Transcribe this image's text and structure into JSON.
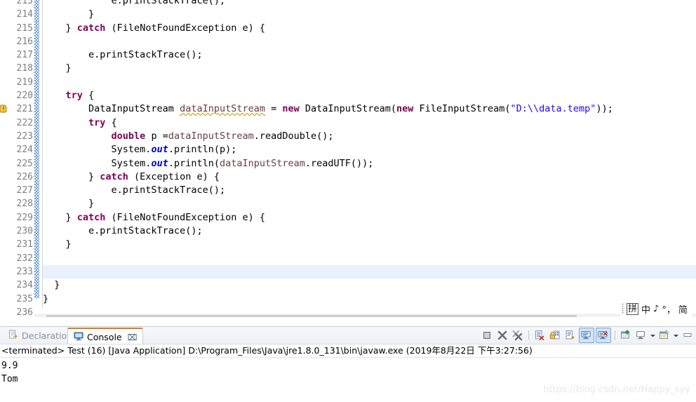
{
  "editor": {
    "current_line_number": 233,
    "warning_line": 221,
    "first_visible_line": 213,
    "lines": [
      {
        "n": 213,
        "clipped": true,
        "tokens": [
          {
            "t": "            e.printStackTrace();",
            "c": "plain"
          }
        ]
      },
      {
        "n": 214,
        "tokens": [
          {
            "t": "        }",
            "c": "plain"
          }
        ]
      },
      {
        "n": 215,
        "tokens": [
          {
            "t": "    } ",
            "c": "plain"
          },
          {
            "t": "catch",
            "c": "kw"
          },
          {
            "t": " (FileNotFoundException e) {",
            "c": "plain"
          }
        ]
      },
      {
        "n": 216,
        "tokens": [
          {
            "t": "",
            "c": "plain"
          }
        ]
      },
      {
        "n": 217,
        "tokens": [
          {
            "t": "        e.printStackTrace();",
            "c": "plain"
          }
        ]
      },
      {
        "n": 218,
        "tokens": [
          {
            "t": "    }",
            "c": "plain"
          }
        ]
      },
      {
        "n": 219,
        "tokens": [
          {
            "t": "",
            "c": "plain"
          }
        ]
      },
      {
        "n": 220,
        "tokens": [
          {
            "t": "    ",
            "c": "plain"
          },
          {
            "t": "try",
            "c": "kw"
          },
          {
            "t": " {",
            "c": "plain"
          }
        ]
      },
      {
        "n": 221,
        "tokens": [
          {
            "t": "        DataInputStream ",
            "c": "plain"
          },
          {
            "t": "dataInputStream",
            "c": "warnu"
          },
          {
            "t": " = ",
            "c": "plain"
          },
          {
            "t": "new",
            "c": "kw"
          },
          {
            "t": " DataInputStream(",
            "c": "plain"
          },
          {
            "t": "new",
            "c": "kw"
          },
          {
            "t": " FileInputStream(",
            "c": "plain"
          },
          {
            "t": "\"D:\\\\data.temp\"",
            "c": "str"
          },
          {
            "t": "));",
            "c": "plain"
          }
        ]
      },
      {
        "n": 222,
        "tokens": [
          {
            "t": "        ",
            "c": "plain"
          },
          {
            "t": "try",
            "c": "kw"
          },
          {
            "t": " {",
            "c": "plain"
          }
        ]
      },
      {
        "n": 223,
        "tokens": [
          {
            "t": "            ",
            "c": "plain"
          },
          {
            "t": "double",
            "c": "kw"
          },
          {
            "t": " p =",
            "c": "plain"
          },
          {
            "t": "dataInputStream",
            "c": "loc"
          },
          {
            "t": ".readDouble();",
            "c": "plain"
          }
        ]
      },
      {
        "n": 224,
        "tokens": [
          {
            "t": "            System.",
            "c": "plain"
          },
          {
            "t": "out",
            "c": "fld"
          },
          {
            "t": ".println(p);",
            "c": "plain"
          }
        ]
      },
      {
        "n": 225,
        "tokens": [
          {
            "t": "            System.",
            "c": "plain"
          },
          {
            "t": "out",
            "c": "fld"
          },
          {
            "t": ".println(",
            "c": "plain"
          },
          {
            "t": "dataInputStream",
            "c": "loc"
          },
          {
            "t": ".readUTF());",
            "c": "plain"
          }
        ]
      },
      {
        "n": 226,
        "tokens": [
          {
            "t": "        } ",
            "c": "plain"
          },
          {
            "t": "catch",
            "c": "kw"
          },
          {
            "t": " (Exception e) {",
            "c": "plain"
          }
        ]
      },
      {
        "n": 227,
        "tokens": [
          {
            "t": "            e.printStackTrace();",
            "c": "plain"
          }
        ]
      },
      {
        "n": 228,
        "tokens": [
          {
            "t": "        }",
            "c": "plain"
          }
        ]
      },
      {
        "n": 229,
        "tokens": [
          {
            "t": "    } ",
            "c": "plain"
          },
          {
            "t": "catch",
            "c": "kw"
          },
          {
            "t": " (FileNotFoundException e) {",
            "c": "plain"
          }
        ]
      },
      {
        "n": 230,
        "tokens": [
          {
            "t": "        e.printStackTrace();",
            "c": "plain"
          }
        ]
      },
      {
        "n": 231,
        "tokens": [
          {
            "t": "    }",
            "c": "plain"
          }
        ]
      },
      {
        "n": 232,
        "tokens": [
          {
            "t": "",
            "c": "plain"
          }
        ]
      },
      {
        "n": 233,
        "tokens": [
          {
            "t": "",
            "c": "plain"
          }
        ],
        "current": true
      },
      {
        "n": 234,
        "tokens": [
          {
            "t": "  }",
            "c": "plain"
          }
        ]
      },
      {
        "n": 235,
        "tokens": [
          {
            "t": "}",
            "c": "plain"
          }
        ]
      },
      {
        "n": 236,
        "tokens": [
          {
            "t": "",
            "c": "plain"
          }
        ]
      }
    ],
    "scrollbar": {
      "left_arrow": "‹",
      "right_arrow": "›"
    }
  },
  "ime_bar": {
    "mode_box": "拼",
    "lang": "中",
    "moon": "♪",
    "punct": "°，",
    "script": "简"
  },
  "bottom_panel": {
    "tabs": [
      {
        "label": "Declaration",
        "icon": "declaration-icon",
        "active": false,
        "closable": false
      },
      {
        "label": "Console",
        "icon": "console-icon",
        "active": true,
        "closable": true,
        "close_glyph": "⌧"
      }
    ],
    "toolbar": [
      {
        "name": "terminate-button",
        "selected": false
      },
      {
        "name": "remove-launch-button",
        "selected": false
      },
      {
        "name": "remove-all-terminated-button",
        "selected": false
      },
      {
        "name": "separator-1",
        "selected": false
      },
      {
        "name": "clear-console-button",
        "selected": false
      },
      {
        "name": "scroll-lock-button",
        "selected": false
      },
      {
        "name": "word-wrap-button",
        "selected": false
      },
      {
        "name": "show-console-on-output-button",
        "selected": true
      },
      {
        "name": "show-console-on-error-button",
        "selected": true
      },
      {
        "name": "separator-2",
        "selected": false
      },
      {
        "name": "pin-console-button",
        "selected": false
      },
      {
        "name": "display-selected-console-button",
        "selected": false
      },
      {
        "name": "display-selected-console-caret",
        "selected": false
      },
      {
        "name": "open-console-button",
        "selected": false
      },
      {
        "name": "open-console-caret",
        "selected": false
      },
      {
        "name": "minimize-button",
        "selected": false
      }
    ],
    "console": {
      "header": "<terminated> Test (16) [Java Application] D:\\Program_Files\\Java\\jre1.8.0_131\\bin\\javaw.exe (2019年8月22日 下午3:27:56)",
      "output": [
        "9.9",
        "Tom"
      ]
    }
  },
  "watermark": "https://blog.csdn.net/Happy_syy",
  "colors": {
    "keyword": "#7f0055",
    "string": "#2a00ff",
    "field": "#0000c0",
    "local": "#6a3e3e",
    "current_line_bg": "#e8f2fe",
    "fold_bar": "#3b7fd4",
    "tab_accent": "#d9821a",
    "selected_tool_bg": "#cfe4fa"
  }
}
